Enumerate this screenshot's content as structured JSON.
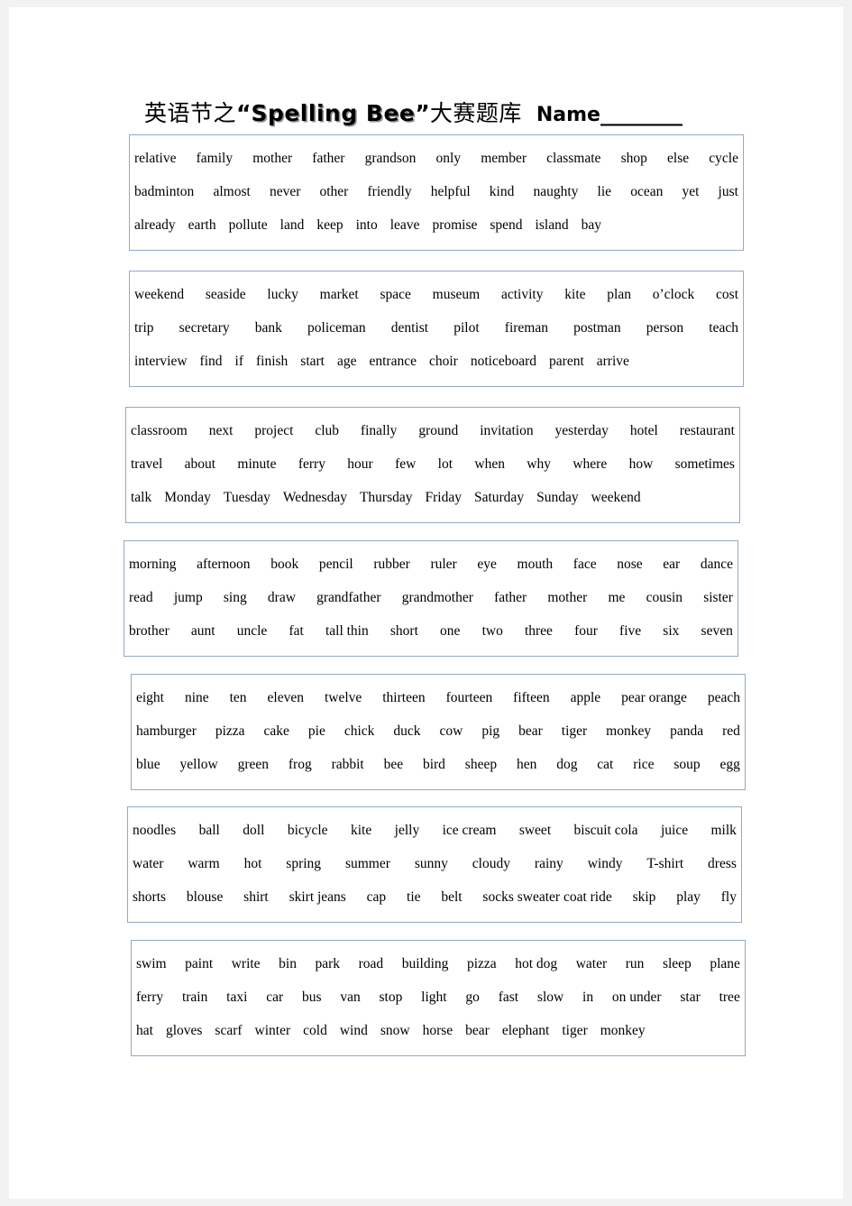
{
  "title": {
    "cjk_prefix": "英语节之",
    "open_quote": "“",
    "bee_text": "Spelling Bee",
    "close_quote": "”",
    "cjk_suffix": "大赛题库",
    "name_label": "Name",
    "name_blank": "_________"
  },
  "colors": {
    "box_border": "#93a9c6",
    "page_background": "#ffffff",
    "canvas_background": "#f2f2f2",
    "text": "#000000"
  },
  "boxes": [
    {
      "index": 1,
      "lines": [
        [
          "relative",
          "family",
          "mother",
          "father",
          "grandson",
          "only",
          "member",
          "classmate",
          "shop",
          "else",
          "cycle"
        ],
        [
          "badminton",
          "almost",
          "never",
          "other",
          "friendly",
          "helpful",
          "kind",
          "naughty",
          "lie",
          "ocean",
          "yet",
          "just"
        ],
        [
          "already",
          "earth",
          "pollute",
          "land",
          "keep",
          "into",
          "leave",
          "promise",
          "spend",
          "island",
          "bay"
        ]
      ],
      "last_line_left_aligned": true
    },
    {
      "index": 2,
      "lines": [
        [
          "weekend",
          "seaside",
          "lucky",
          "market",
          "space",
          "museum",
          "activity",
          "kite",
          "plan",
          "o’clock",
          "cost"
        ],
        [
          "trip",
          "secretary",
          "bank",
          "policeman",
          "dentist",
          "pilot",
          "fireman",
          "postman",
          "person",
          "teach"
        ],
        [
          "interview",
          "find",
          "if",
          "finish",
          "start",
          "age",
          "entrance",
          "choir",
          "noticeboard",
          "parent",
          "arrive"
        ]
      ],
      "last_line_left_aligned": true
    },
    {
      "index": 3,
      "lines": [
        [
          "classroom",
          "next",
          "project",
          "club",
          "finally",
          "ground",
          "invitation",
          "yesterday",
          "hotel",
          "restaurant"
        ],
        [
          "travel",
          "about",
          "minute",
          "ferry",
          "hour",
          "few",
          "lot",
          "when",
          "why",
          "where",
          "how",
          "sometimes"
        ],
        [
          "talk",
          "Monday",
          "Tuesday",
          "Wednesday",
          "Thursday",
          "Friday",
          "Saturday",
          "Sunday",
          "weekend"
        ]
      ],
      "last_line_left_aligned": true
    },
    {
      "index": 4,
      "lines": [
        [
          "morning",
          "afternoon",
          "book",
          "pencil",
          "rubber",
          "ruler",
          "eye",
          "mouth",
          "face",
          "nose",
          "ear",
          "dance"
        ],
        [
          "read",
          "jump",
          "sing",
          "draw",
          "grandfather",
          "grandmother",
          "father",
          "mother",
          "me",
          "cousin",
          "sister"
        ],
        [
          "brother",
          "aunt",
          "uncle",
          "fat",
          "tall thin",
          "short",
          "one",
          "two",
          "three",
          "four",
          "five",
          "six",
          "seven"
        ]
      ],
      "last_line_left_aligned": false
    },
    {
      "index": 5,
      "lines": [
        [
          "eight",
          "nine",
          "ten",
          "eleven",
          "twelve",
          "thirteen",
          "fourteen",
          "fifteen",
          "apple",
          "pear orange",
          "peach"
        ],
        [
          "hamburger",
          "pizza",
          "cake",
          "pie",
          "chick",
          "duck",
          "cow",
          "pig",
          "bear",
          "tiger",
          "monkey",
          "panda",
          "red"
        ],
        [
          "blue",
          "yellow",
          "green",
          "frog",
          "rabbit",
          "bee",
          "bird",
          "sheep",
          "hen",
          "dog",
          "cat",
          "rice",
          "soup",
          "egg"
        ]
      ],
      "last_line_left_aligned": false
    },
    {
      "index": 6,
      "lines": [
        [
          "noodles",
          "ball",
          "doll",
          "bicycle",
          "kite",
          "jelly",
          "ice cream",
          "sweet",
          "biscuit cola",
          "juice",
          "milk"
        ],
        [
          "water",
          "warm",
          "hot",
          "spring",
          "summer",
          "sunny",
          "cloudy",
          "rainy",
          "windy",
          "T-shirt",
          "dress"
        ],
        [
          "shorts",
          "blouse",
          "shirt",
          "skirt jeans",
          "cap",
          "tie",
          "belt",
          "socks sweater coat ride",
          "skip",
          "play",
          "fly"
        ]
      ],
      "last_line_left_aligned": false
    },
    {
      "index": 7,
      "lines": [
        [
          "swim",
          "paint",
          "write",
          "bin",
          "park",
          "road",
          "building",
          "pizza",
          "hot dog",
          "water",
          "run",
          "sleep",
          "plane"
        ],
        [
          "ferry",
          "train",
          "taxi",
          "car",
          "bus",
          "van",
          "stop",
          "light",
          "go",
          "fast",
          "slow",
          "in",
          "on under",
          "star",
          "tree"
        ],
        [
          "hat",
          "gloves",
          "scarf",
          "winter",
          "cold",
          "wind",
          "snow",
          "horse",
          "bear",
          "elephant",
          "tiger",
          "monkey"
        ]
      ],
      "last_line_left_aligned": true
    }
  ]
}
